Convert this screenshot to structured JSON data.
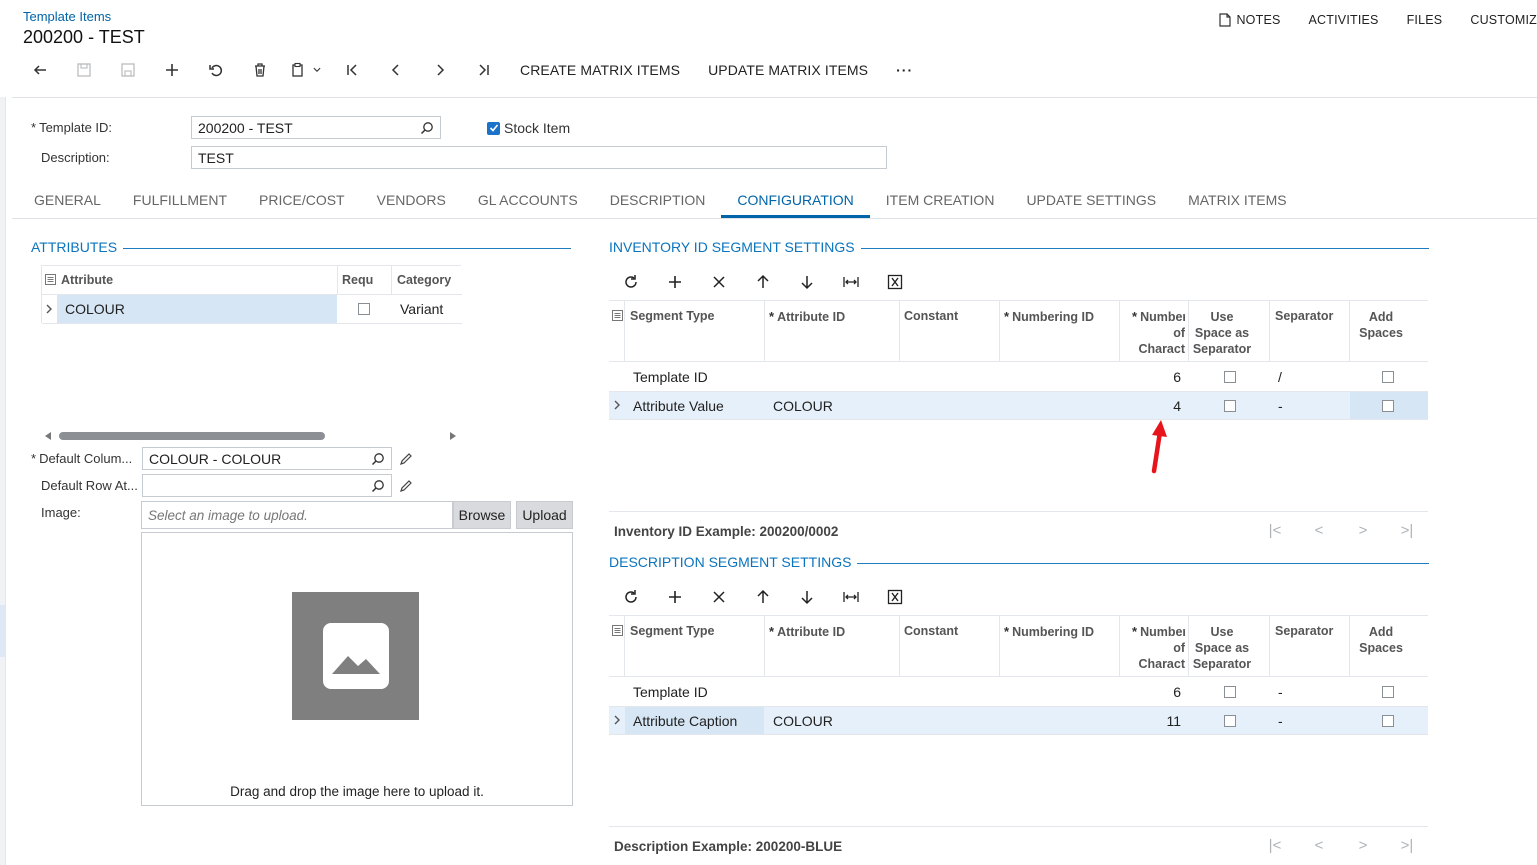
{
  "header": {
    "breadcrumb": "Template Items",
    "title": "200200 - TEST",
    "links": [
      "NOTES",
      "ACTIVITIES",
      "FILES",
      "CUSTOMIZ"
    ]
  },
  "toolbar": {
    "create_matrix": "CREATE MATRIX ITEMS",
    "update_matrix": "UPDATE MATRIX ITEMS",
    "more": "···"
  },
  "form": {
    "template_id_label": "Template ID:",
    "template_id_value": "200200 - TEST",
    "stock_item_label": "Stock Item",
    "description_label": "Description:",
    "description_value": "TEST"
  },
  "tabs": [
    "GENERAL",
    "FULFILLMENT",
    "PRICE/COST",
    "VENDORS",
    "GL ACCOUNTS",
    "DESCRIPTION",
    "CONFIGURATION",
    "ITEM CREATION",
    "UPDATE SETTINGS",
    "MATRIX ITEMS"
  ],
  "attributes": {
    "title": "ATTRIBUTES",
    "columns": [
      "Attribute",
      "Requ",
      "Category"
    ],
    "rows": [
      {
        "attribute": "COLOUR",
        "category": "Variant"
      }
    ],
    "default_column_label": "Default Colum...",
    "default_column_value": "COLOUR - COLOUR",
    "default_row_label": "Default Row At...",
    "default_row_value": "",
    "image_label": "Image:",
    "image_placeholder": "Select an image to upload.",
    "browse": "Browse",
    "upload": "Upload",
    "drop_text": "Drag and drop the image here to upload it."
  },
  "inventory_segments": {
    "title": "INVENTORY ID SEGMENT SETTINGS",
    "columns": {
      "segment_type": "Segment Type",
      "attribute_id": "Attribute ID",
      "constant": "Constant",
      "numbering_id": "Numbering ID",
      "num_chars": "Number of Charact",
      "use_space": "Use Space as Separator",
      "separator": "Separator",
      "add_spaces": "Add Spaces"
    },
    "rows": [
      {
        "segment_type": "Template ID",
        "attribute_id": "",
        "num": "6",
        "separator": "/"
      },
      {
        "segment_type": "Attribute Value",
        "attribute_id": "COLOUR",
        "num": "4",
        "separator": "-"
      }
    ],
    "example": "Inventory ID Example: 200200/0002"
  },
  "description_segments": {
    "title": "DESCRIPTION SEGMENT SETTINGS",
    "columns": {
      "segment_type": "Segment Type",
      "attribute_id": "Attribute ID",
      "constant": "Constant",
      "numbering_id": "Numbering ID",
      "num_chars": "Number of Charact",
      "use_space": "Use Space as Separator",
      "separator": "Separator",
      "add_spaces": "Add Spaces"
    },
    "rows": [
      {
        "segment_type": "Template ID",
        "attribute_id": "",
        "num": "6",
        "separator": "-"
      },
      {
        "segment_type": "Attribute Caption",
        "attribute_id": "COLOUR",
        "num": "11",
        "separator": "-"
      }
    ],
    "example": "Description Example: 200200-BLUE"
  },
  "colors": {
    "accent": "#0064a8",
    "annotation_arrow": "#e8141c",
    "selected_row": "#e6f0fa"
  }
}
